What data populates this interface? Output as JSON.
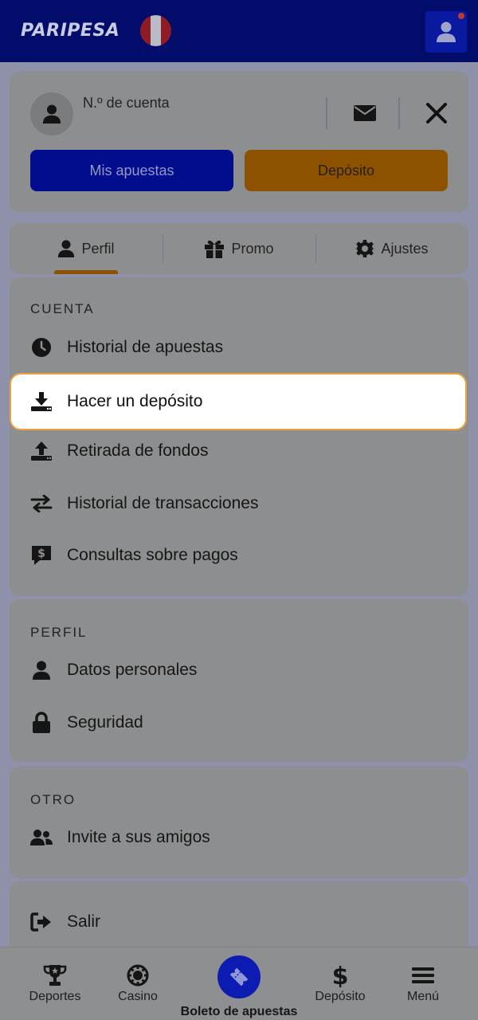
{
  "header": {
    "logo_text": "PARIPESA",
    "flag_icon": "peru-flag-icon",
    "profile_icon": "user-icon"
  },
  "account": {
    "account_label": "N.º de cuenta",
    "my_bets_label": "Mis apuestas",
    "deposit_label": "Depósito"
  },
  "tabs": [
    {
      "label": "Perfil",
      "icon": "user-icon",
      "active": true
    },
    {
      "label": "Promo",
      "icon": "gift-icon",
      "active": false
    },
    {
      "label": "Ajustes",
      "icon": "gear-icon",
      "active": false
    }
  ],
  "sections": {
    "account": {
      "title": "CUENTA",
      "items": [
        {
          "label": "Historial de apuestas",
          "icon": "clock-icon"
        },
        {
          "label": "Hacer un depósito",
          "icon": "download-icon",
          "highlighted": true
        },
        {
          "label": "Retirada de fondos",
          "icon": "upload-icon"
        },
        {
          "label": "Historial de transacciones",
          "icon": "transfer-arrows-icon"
        },
        {
          "label": "Consultas sobre pagos",
          "icon": "payment-chat-icon"
        }
      ]
    },
    "profile": {
      "title": "PERFIL",
      "items": [
        {
          "label": "Datos personales",
          "icon": "user-icon"
        },
        {
          "label": "Seguridad",
          "icon": "lock-icon"
        }
      ]
    },
    "other": {
      "title": "OTRO",
      "items": [
        {
          "label": "Invite a sus amigos",
          "icon": "users-icon"
        }
      ]
    },
    "logout": {
      "items": [
        {
          "label": "Salir",
          "icon": "logout-icon"
        }
      ]
    }
  },
  "bottom_nav": [
    {
      "label": "Deportes",
      "icon": "trophy-icon"
    },
    {
      "label": "Casino",
      "icon": "casino-chip-icon"
    },
    {
      "label": "Boleto de apuestas",
      "icon": "ticket-icon",
      "active": true
    },
    {
      "label": "Depósito",
      "icon": "dollar-icon"
    },
    {
      "label": "Menú",
      "icon": "hamburger-icon"
    }
  ],
  "colors": {
    "header_bg": "#020c6b",
    "primary_blue": "#020d8e",
    "deposit_orange": "#8d5200",
    "highlight_border": "#f0a23a"
  }
}
